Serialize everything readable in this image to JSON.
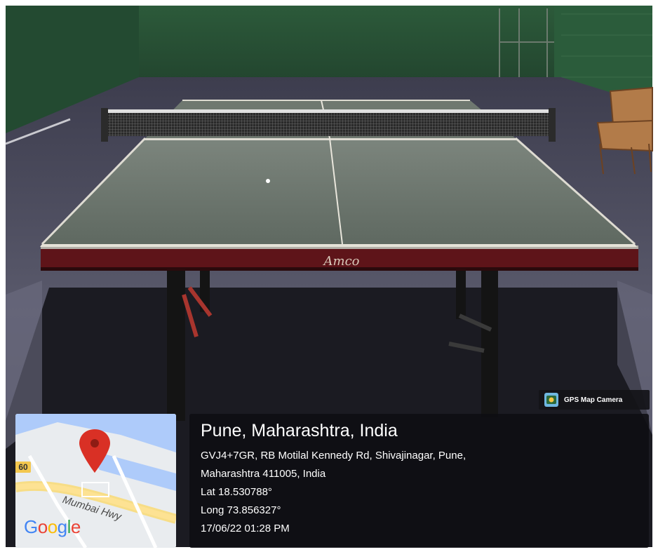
{
  "photo": {
    "table_brand": "Amco"
  },
  "badge": {
    "label": "GPS Map Camera",
    "icon": "gps-map-camera-icon"
  },
  "map": {
    "road_number": "60",
    "road_name": "Mumbai Hwy",
    "logo_letters": [
      {
        "ch": "G",
        "color": "#4285F4"
      },
      {
        "ch": "o",
        "color": "#EA4335"
      },
      {
        "ch": "o",
        "color": "#FBBC05"
      },
      {
        "ch": "g",
        "color": "#4285F4"
      },
      {
        "ch": "l",
        "color": "#34A853"
      },
      {
        "ch": "e",
        "color": "#EA4335"
      }
    ],
    "pin_icon": "map-pin-icon",
    "pin_color": "#D93025"
  },
  "location": {
    "title": "Pune, Maharashtra, India",
    "address_line1": "GVJ4+7GR, RB Motilal Kennedy Rd, Shivajinagar, Pune,",
    "address_line2": "Maharashtra 411005, India",
    "lat": "Lat 18.530788°",
    "long": "Long 73.856327°",
    "datetime": "17/06/22 01:28 PM"
  },
  "colors": {
    "wall": "#2f5a3c",
    "floor": "#50505f",
    "table_top": "#66706a",
    "table_apron": "#5e1419"
  }
}
